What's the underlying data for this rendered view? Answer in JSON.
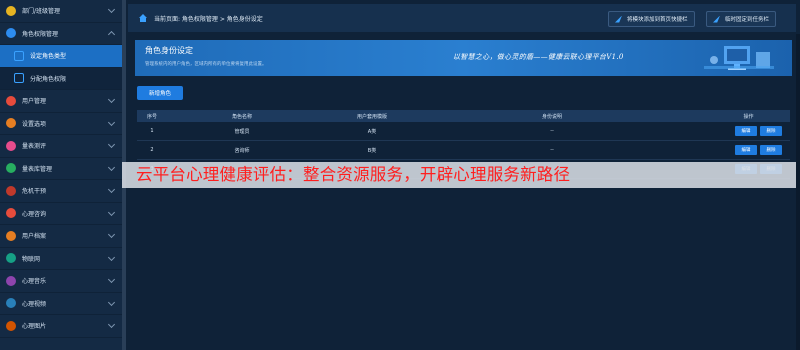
{
  "sidebar": {
    "items": [
      {
        "label": "部门/班级管理",
        "icon": "department-icon",
        "color": "#e6b422",
        "chevron": "down"
      },
      {
        "label": "角色权限管理",
        "icon": "role-permission-icon",
        "color": "#2d8cf0",
        "chevron": "up"
      },
      {
        "label": "设定角色类型",
        "icon": "settings-icon",
        "color": "#3aa1ff",
        "sub": true,
        "active": true
      },
      {
        "label": "分配角色权限",
        "icon": "puzzle-icon",
        "color": "#3aa1ff",
        "sub": true
      },
      {
        "label": "用户管理",
        "icon": "user-icon",
        "color": "#e64b3c",
        "chevron": "down"
      },
      {
        "label": "设置选项",
        "icon": "options-icon",
        "color": "#e67e22",
        "chevron": "down"
      },
      {
        "label": "量表测评",
        "icon": "heart-icon",
        "color": "#e74c8c",
        "chevron": "down"
      },
      {
        "label": "量表库管理",
        "icon": "library-icon",
        "color": "#27ae60",
        "chevron": "down"
      },
      {
        "label": "危机干预",
        "icon": "crisis-icon",
        "color": "#c0392b",
        "chevron": "down"
      },
      {
        "label": "心理咨询",
        "icon": "consult-icon",
        "color": "#e74c3c",
        "chevron": "down"
      },
      {
        "label": "用户档案",
        "icon": "archive-icon",
        "color": "#e67e22",
        "chevron": "down"
      },
      {
        "label": "物联网",
        "icon": "iot-icon",
        "color": "#16a085",
        "chevron": "down"
      },
      {
        "label": "心理音乐",
        "icon": "music-icon",
        "color": "#8e44ad",
        "chevron": "down"
      },
      {
        "label": "心理视频",
        "icon": "video-icon",
        "color": "#2980b9",
        "chevron": "down"
      },
      {
        "label": "心理图片",
        "icon": "image-icon",
        "color": "#d35400",
        "chevron": "down"
      }
    ]
  },
  "topbar": {
    "breadcrumb": "当前页面: 角色权限管理 > 角色身份设定",
    "add_shortcut_label": "将模块添加到首页快捷栏",
    "pin_taskbar_label": "临时固定到任务栏"
  },
  "banner": {
    "title": "角色身份设定",
    "subtitle": "管理系统内的用户角色，区域内所有的单位要将复用此设置。",
    "slogan": "以智慧之心，做心灵的盾——健康云联心理平台V1.0"
  },
  "new_button_label": "新增角色",
  "table": {
    "headers": [
      "序号",
      "角色名称",
      "用户套用模版",
      "身份说明",
      "操作"
    ],
    "rows": [
      {
        "index": "1",
        "name": "管理员",
        "template": "A类",
        "desc": "--"
      },
      {
        "index": "2",
        "name": "咨询师",
        "template": "B类",
        "desc": "--"
      },
      {
        "index": "3",
        "name": "",
        "template": "",
        "desc": ""
      }
    ],
    "edit_label": "编辑",
    "delete_label": "删除"
  },
  "overlay_caption": "云平台心理健康评估：整合资源服务，开辟心理服务新路径",
  "colors": {
    "accent": "#1f7ce0",
    "caption": "#ff1f1f",
    "background": "#0f2238"
  }
}
